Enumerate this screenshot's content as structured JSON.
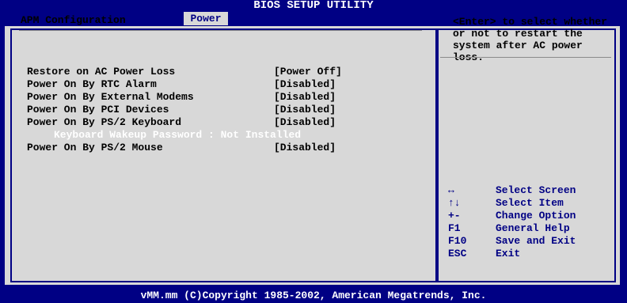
{
  "header": {
    "title": "BIOS SETUP UTILITY",
    "active_menu": "Power"
  },
  "section": {
    "title": "APM Configuration"
  },
  "items": [
    {
      "label": "Restore on AC Power Loss",
      "value": "[Power Off]"
    },
    {
      "label": "Power On By RTC Alarm",
      "value": "[Disabled]"
    },
    {
      "label": "Power On By External Modems",
      "value": "[Disabled]"
    },
    {
      "label": "Power On By PCI Devices",
      "value": "[Disabled]"
    },
    {
      "label": "Power On By PS/2 Keyboard",
      "value": "[Disabled]"
    },
    {
      "label": "Keyboard Wakeup Password : Not Installed"
    },
    {
      "label": "Power On By PS/2 Mouse",
      "value": "[Disabled]"
    }
  ],
  "help": {
    "text": "<Enter> to select whether or not to restart the system after AC power loss."
  },
  "keys": [
    {
      "key": "↔",
      "desc": "Select Screen"
    },
    {
      "key": "↑↓",
      "desc": "Select Item"
    },
    {
      "key": "+-",
      "desc": "Change Option"
    },
    {
      "key": "F1",
      "desc": "General Help"
    },
    {
      "key": "F10",
      "desc": "Save and Exit"
    },
    {
      "key": "ESC",
      "desc": "Exit"
    }
  ],
  "footer": {
    "text": "vMM.mm (C)Copyright 1985-2002, American Megatrends, Inc."
  },
  "colors": {
    "background": "#000084",
    "panel": "#d8d8d8",
    "highlight_text": "#ffffff"
  }
}
